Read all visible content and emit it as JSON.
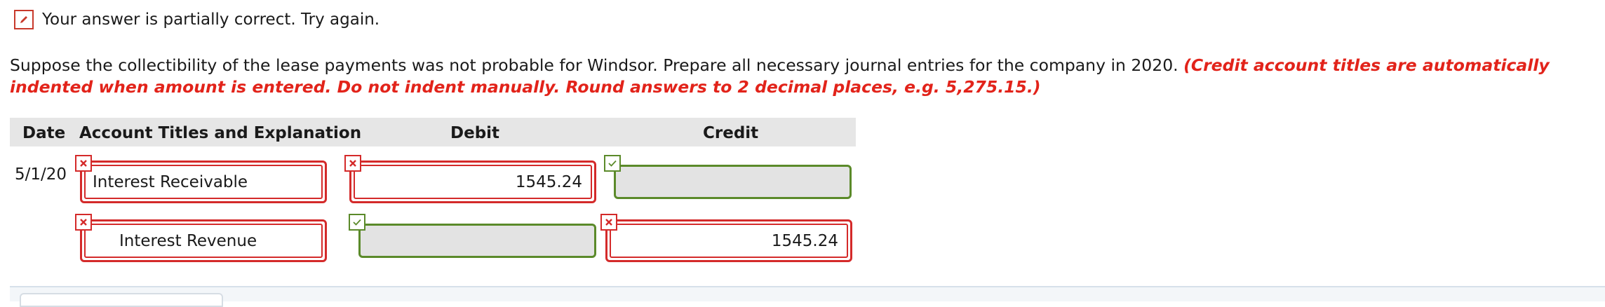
{
  "status": {
    "message": "Your answer is partially correct.  Try again.",
    "icon": "pencil-icon",
    "color": "#c8392b"
  },
  "instructions": {
    "text": "Suppose the collectibility of the lease payments was not probable for Windsor. Prepare all necessary journal entries for the company in 2020.",
    "emphasis": "(Credit account titles are automatically indented when amount is entered. Do not indent manually. Round answers to 2 decimal places, e.g. 5,275.15.)",
    "emphasis_color": "#e2231a"
  },
  "table": {
    "headers": {
      "date": "Date",
      "account": "Account Titles and Explanation",
      "debit": "Debit",
      "credit": "Credit"
    },
    "rows": [
      {
        "date": "5/1/20",
        "account": "Interest Receivable",
        "account_status": "incorrect",
        "debit": "1545.24",
        "debit_status": "incorrect",
        "credit": "",
        "credit_status": "correct"
      },
      {
        "date": "",
        "account": "Interest Revenue",
        "account_status": "incorrect",
        "debit": "",
        "debit_status": "correct",
        "credit": "1545.24",
        "credit_status": "incorrect"
      }
    ]
  },
  "colors": {
    "error": "#d42a2a",
    "correct": "#5b8a2a",
    "header_bg": "#e6e6e6"
  }
}
